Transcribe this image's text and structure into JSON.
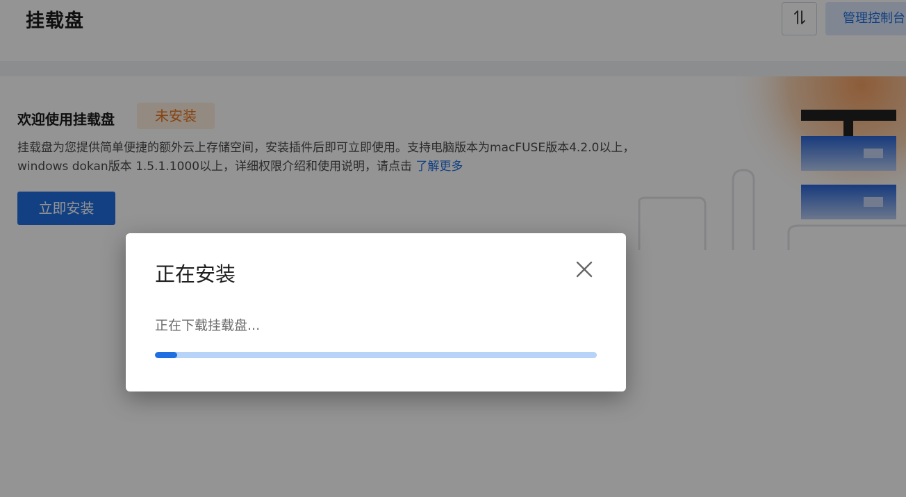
{
  "header": {
    "title": "挂载盘",
    "console_label": "管理控制台"
  },
  "banner": {
    "welcome_title": "欢迎使用挂载盘",
    "status_badge": "未安装",
    "description": "挂载盘为您提供简单便捷的额外云上存储空间，安装插件后即可立即使用。支持电脑版本为macFUSE版本4.2.0以上，windows dokan版本 1.5.1.1000以上，详细权限介绍和使用说明，请点击 ",
    "learn_more": "了解更多",
    "install_button": "立即安装"
  },
  "dialog": {
    "title": "正在安装",
    "status": "正在下载挂载盘...",
    "progress_percent": 5
  },
  "icons": {
    "sort": "sort-icon",
    "close": "close-icon"
  },
  "colors": {
    "accent": "#1f6fe0",
    "progress_track": "#b7d3f8",
    "badge_text": "#e8741c",
    "badge_bg": "#fdeede"
  }
}
